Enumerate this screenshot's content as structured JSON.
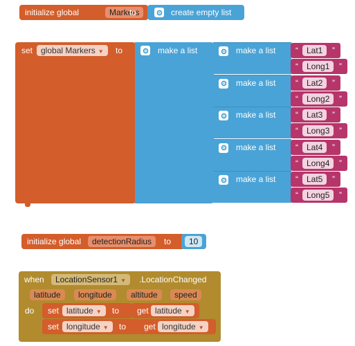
{
  "block1": {
    "prefix": "initialize global",
    "var_name": "Markers",
    "to": "to",
    "value": "create empty list"
  },
  "block2": {
    "set": "set",
    "var_name": "global Markers",
    "to": "to",
    "outer_list": "make a list",
    "inner_list_label": "make a list",
    "pairs": [
      {
        "lat": "Lat1",
        "long": "Long1"
      },
      {
        "lat": "Lat2",
        "long": "Long2"
      },
      {
        "lat": "Lat3",
        "long": "Long3"
      },
      {
        "lat": "Lat4",
        "long": "Long4"
      },
      {
        "lat": "Lat5",
        "long": "Long5"
      }
    ],
    "quote_open": "“",
    "quote_close": "”"
  },
  "block3": {
    "prefix": "initialize global",
    "var_name": "detectionRadius",
    "to": "to",
    "value": "10"
  },
  "block4": {
    "when": "when",
    "component": "LocationSensor1",
    "event": ".LocationChanged",
    "params": [
      "latitude",
      "longitude",
      "altitude",
      "speed"
    ],
    "do": "do",
    "statements": [
      {
        "set": "set",
        "var": "latitude",
        "to": "to",
        "get": "get",
        "get_var": "latitude"
      },
      {
        "set": "set",
        "var": "longitude",
        "to": "to",
        "get": "get",
        "get_var": "longitude"
      }
    ]
  },
  "colors": {
    "variable_orange": "#d35d2b",
    "list_blue": "#4aa3d6",
    "text_pink": "#b6356a",
    "event_olive": "#b18b2e"
  }
}
